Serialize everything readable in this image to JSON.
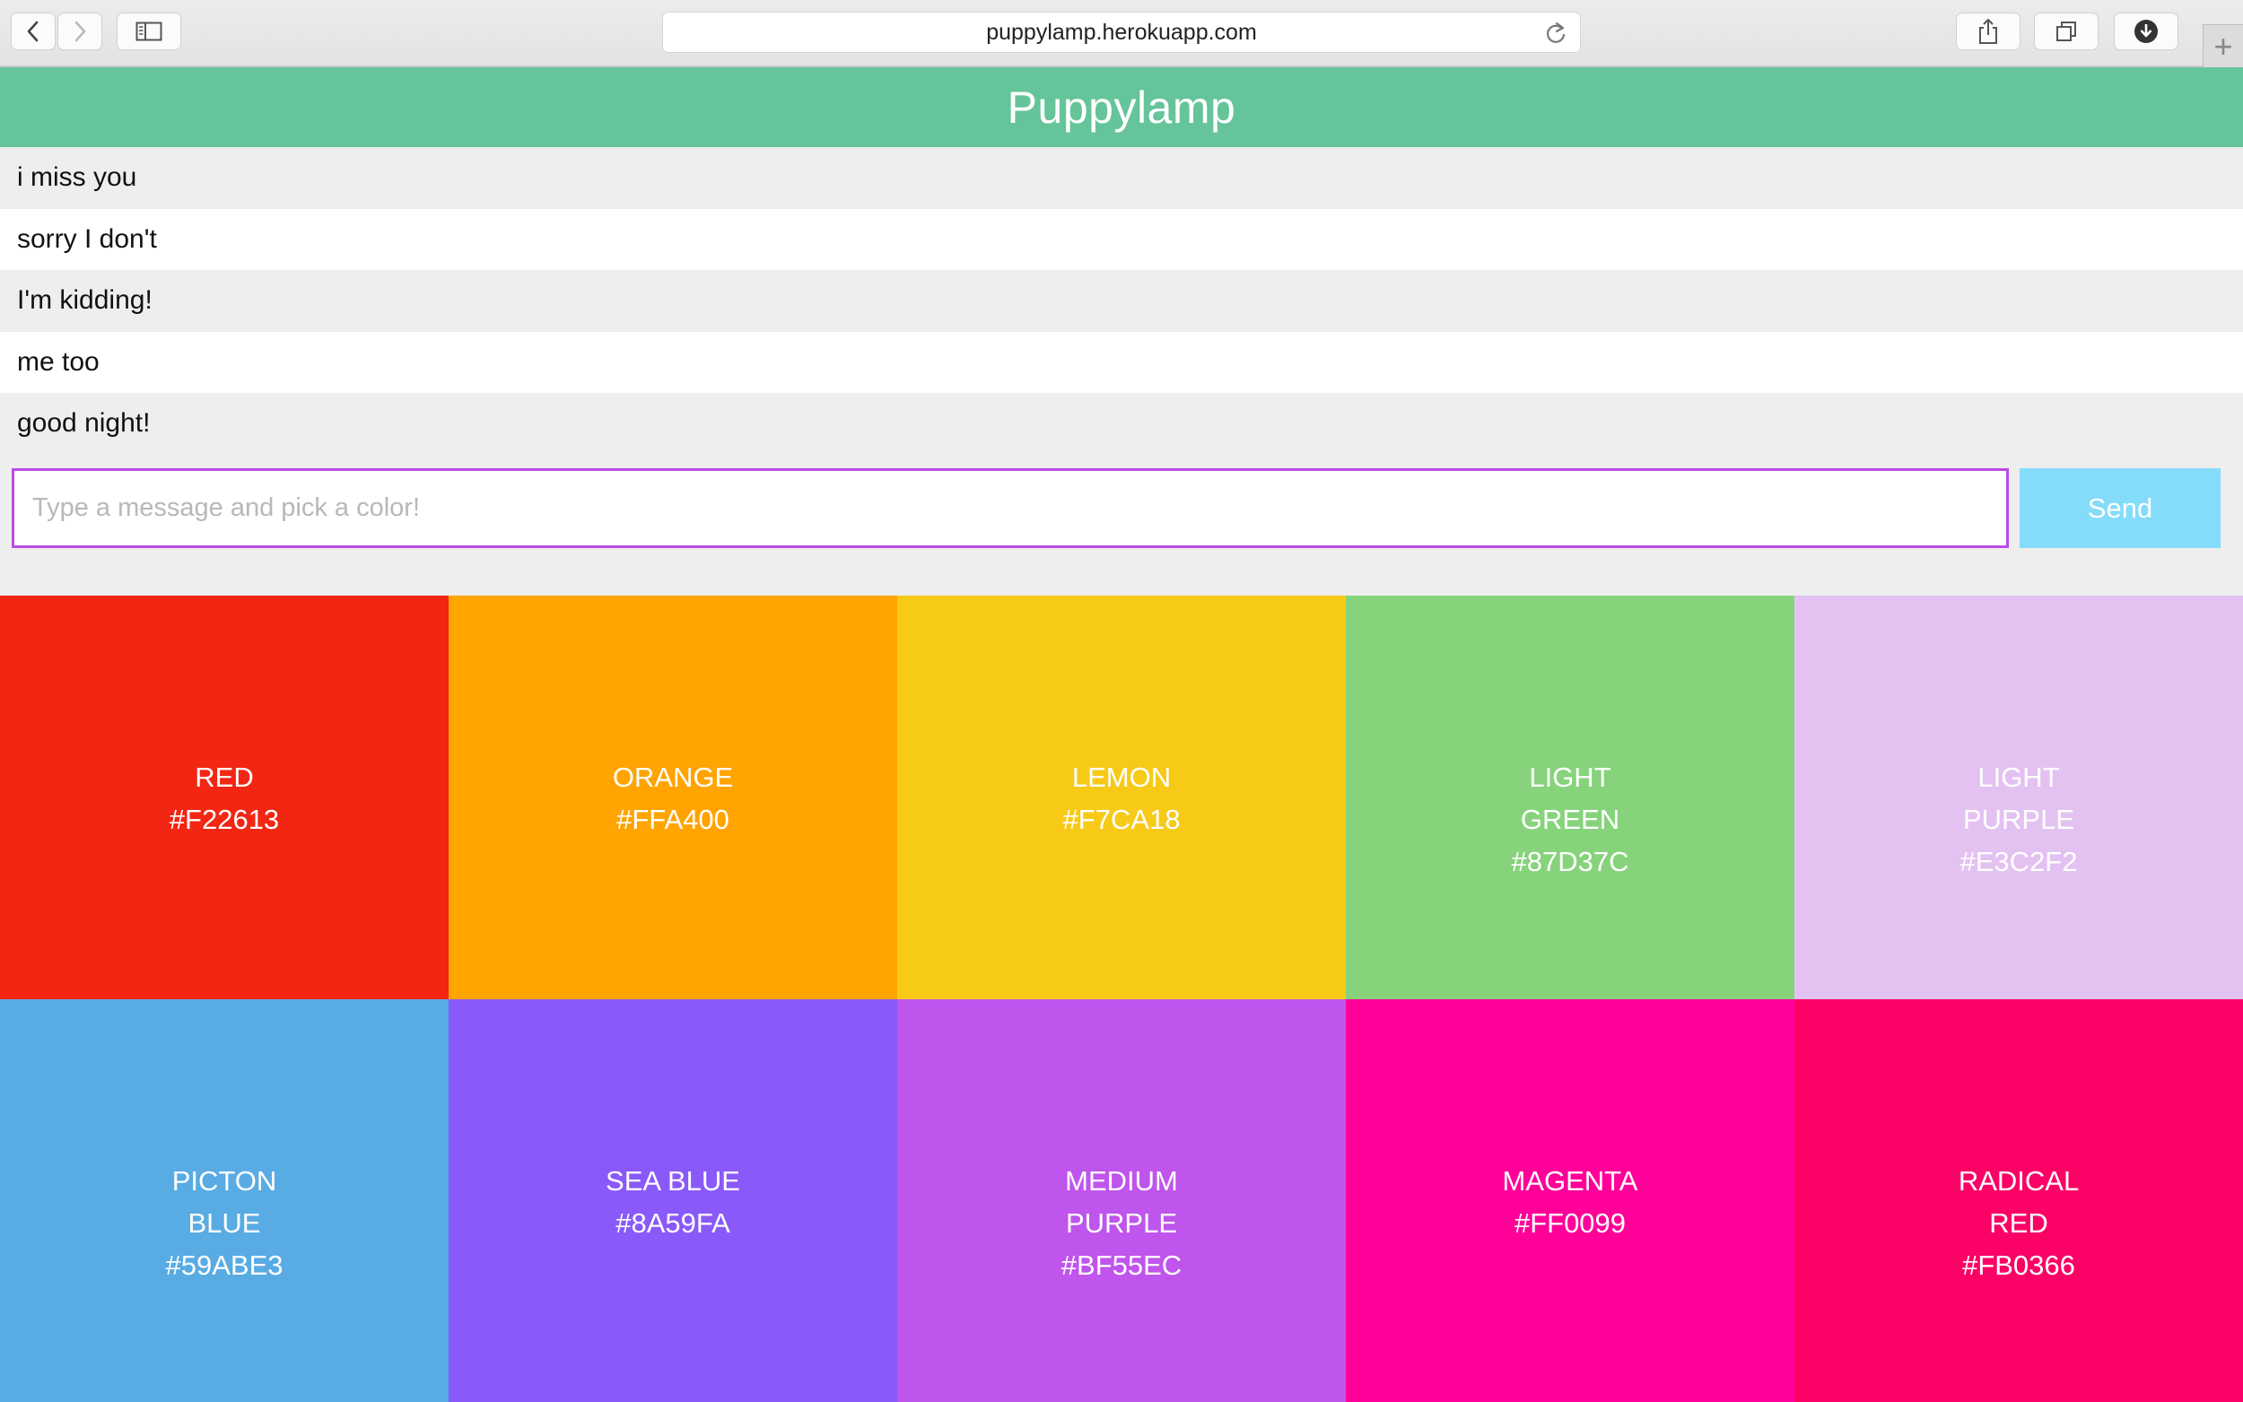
{
  "browser": {
    "url": "puppylamp.herokuapp.com",
    "icons": {
      "back": "chevron-left-icon",
      "forward": "chevron-right-icon",
      "sidebar": "sidebar-icon",
      "reload": "reload-icon",
      "share": "share-icon",
      "tabs": "tabs-overview-icon",
      "downloads": "download-icon",
      "new_tab": "plus-icon"
    }
  },
  "app": {
    "title": "Puppylamp",
    "accent_color": "#65C49A"
  },
  "messages": [
    "i miss you",
    "sorry I don't",
    "I'm kidding!",
    "me too",
    "good night!"
  ],
  "composer": {
    "placeholder": "Type a message and pick a color!",
    "value": "",
    "send_label": "Send",
    "send_color": "#84DCFA"
  },
  "colors": [
    {
      "name": "RED",
      "hex": "#F22613"
    },
    {
      "name": "ORANGE",
      "hex": "#FFA400"
    },
    {
      "name": "LEMON",
      "hex": "#F7CA18"
    },
    {
      "name": "LIGHT\nGREEN",
      "hex": "#87D37C"
    },
    {
      "name": "LIGHT\nPURPLE",
      "hex": "#E3C2F2"
    },
    {
      "name": "PICTON\nBLUE",
      "hex": "#59ABE3"
    },
    {
      "name": "SEA BLUE",
      "hex": "#8A59FA"
    },
    {
      "name": "MEDIUM\nPURPLE",
      "hex": "#BF55EC"
    },
    {
      "name": "MAGENTA",
      "hex": "#FF0099"
    },
    {
      "name": "RADICAL\nRED",
      "hex": "#FB0366"
    }
  ]
}
